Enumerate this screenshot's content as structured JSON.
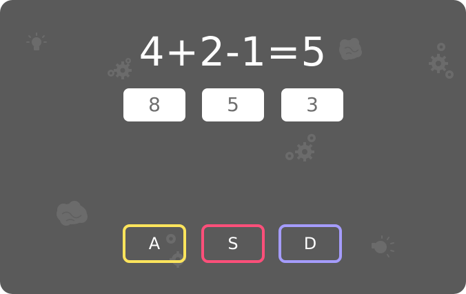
{
  "game": {
    "equation": "4+2-1=5",
    "answers": [
      {
        "value": "8"
      },
      {
        "value": "5"
      },
      {
        "value": "3"
      }
    ],
    "keys": [
      {
        "label": "A",
        "color": "#ffe55c"
      },
      {
        "label": "S",
        "color": "#ff4f7a"
      },
      {
        "label": "D",
        "color": "#a59cff"
      }
    ]
  },
  "theme": {
    "background": "#5a5a5a",
    "text": "#ffffff",
    "answer_box": "#ffffff",
    "answer_text": "#6e6e6e",
    "deco": "#6b6b6b"
  },
  "decorations": [
    "lightbulb-icon",
    "gears-icon",
    "brain-icon",
    "gears-icon",
    "gears-icon",
    "brain-icon",
    "gears-icon",
    "lightbulb-icon"
  ]
}
